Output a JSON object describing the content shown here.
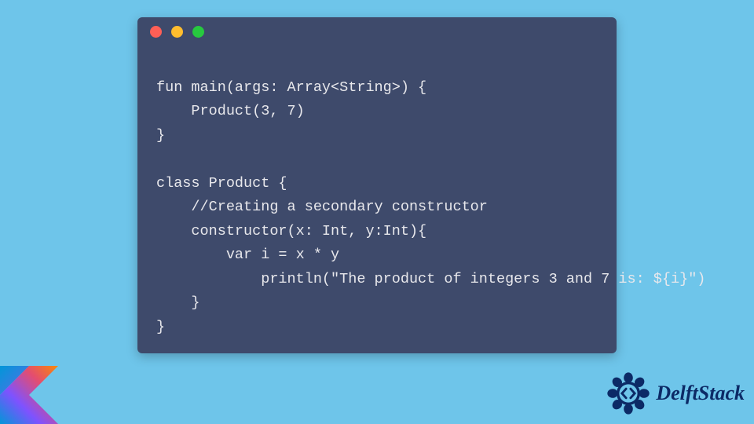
{
  "code": {
    "lines": [
      "fun main(args: Array<String>) {",
      "    Product(3, 7)",
      "}",
      "",
      "class Product {",
      "    //Creating a secondary constructor",
      "    constructor(x: Int, y:Int){",
      "        var i = x * y",
      "            println(\"The product of integers 3 and 7 is: ${i}\")",
      "    }",
      "}"
    ]
  },
  "window": {
    "buttons": {
      "close": "close",
      "min": "minimize",
      "max": "maximize"
    }
  },
  "branding": {
    "kotlin_alt": "Kotlin logo",
    "delft_text": "DelftStack"
  },
  "colors": {
    "bg": "#6ec5ea",
    "window": "#3e4a6b",
    "code_text": "#e8e8ec",
    "dot_red": "#ff5f56",
    "dot_yellow": "#ffbd2e",
    "dot_green": "#27c93f",
    "delft_blue": "#0c2a66"
  }
}
